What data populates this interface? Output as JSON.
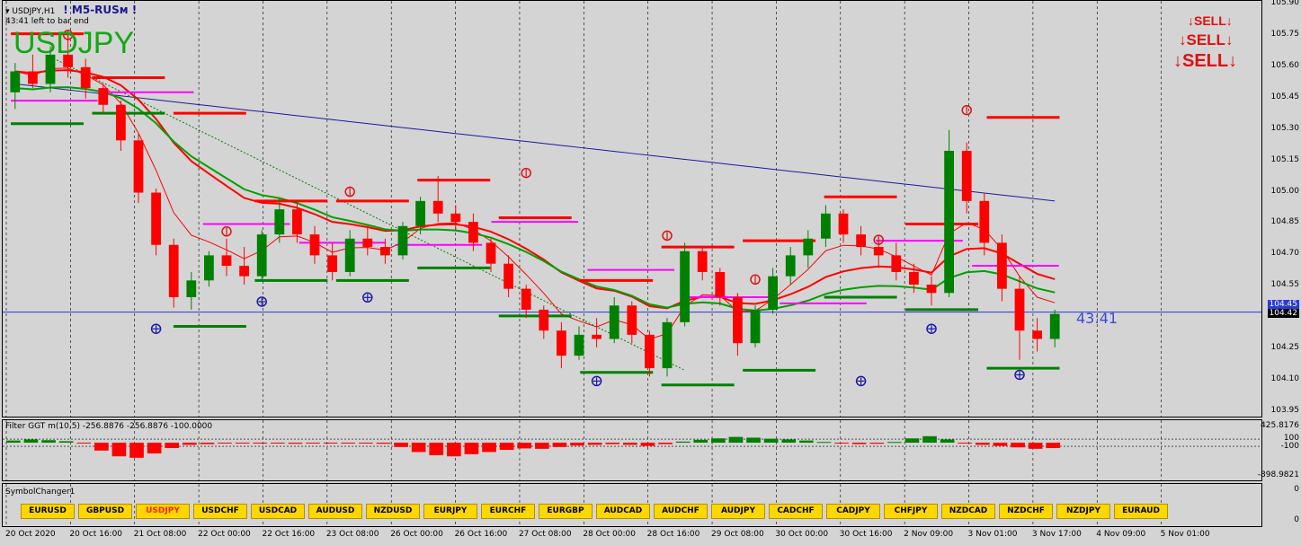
{
  "header": {
    "symbol_tf": "USDJPY,H1",
    "brand": "! M5-RUSм !",
    "bar_timer": "43:41 left to bar end",
    "big_symbol": "USDJPY",
    "timer_big": "43:41"
  },
  "sell_signals": [
    "SELL",
    "SELL",
    "SELL"
  ],
  "price_scale": [
    "105.90",
    "105.75",
    "105.60",
    "105.45",
    "105.30",
    "105.15",
    "105.00",
    "104.85",
    "104.70",
    "104.55",
    "104.42",
    "104.25",
    "104.10",
    "103.95"
  ],
  "price_tags": {
    "bid": "104.42",
    "ask": "104.45"
  },
  "indicator": {
    "label": "Filter GGT m(10,5) -256.8876 -256.8876 -100.0000",
    "scale": [
      "425.8176",
      "100",
      "-100",
      "-898.9821"
    ]
  },
  "symbol_changer": {
    "title": "SymbolChanger1",
    "scale": [
      "0",
      "0"
    ],
    "active": "USDJPY",
    "symbols": [
      "EURUSD",
      "GBPUSD",
      "USDJPY",
      "USDCHF",
      "USDCAD",
      "AUDUSD",
      "NZDUSD",
      "EURJPY",
      "EURCHF",
      "EURGBP",
      "AUDCAD",
      "AUDCHF",
      "AUDJPY",
      "CADCHF",
      "CADJPY",
      "CHFJPY",
      "NZDCAD",
      "NZDCHF",
      "NZDJPY",
      "EURAUD"
    ]
  },
  "time_axis": [
    "20 Oct 2020",
    "20 Oct 16:00",
    "21 Oct 08:00",
    "22 Oct 00:00",
    "22 Oct 16:00",
    "23 Oct 08:00",
    "26 Oct 00:00",
    "26 Oct 16:00",
    "27 Oct 08:00",
    "28 Oct 00:00",
    "28 Oct 16:00",
    "29 Oct 08:00",
    "30 Oct 00:00",
    "30 Oct 16:00",
    "2 Nov 09:00",
    "3 Nov 01:00",
    "3 Nov 17:00",
    "4 Nov 09:00",
    "5 Nov 01:00"
  ],
  "colors": {
    "bull": "#008000",
    "bear": "#ff0000",
    "ma_fast": "#ff0000",
    "ma_slow": "#00a000",
    "ma_long": "#1a1aa0",
    "resistance": "#ff0000",
    "support": "#008000",
    "pivot": "#ff00ff",
    "button": "#ffd700",
    "background": "#d4d4d4"
  },
  "chart_data": {
    "type": "candlestick",
    "symbol": "USDJPY",
    "timeframe": "H1",
    "ylim": [
      103.95,
      105.9
    ],
    "current_price": 104.42,
    "candles": [
      [
        105.48,
        105.62,
        105.4,
        105.58
      ],
      [
        105.58,
        105.66,
        105.5,
        105.52
      ],
      [
        105.52,
        105.7,
        105.48,
        105.66
      ],
      [
        105.66,
        105.78,
        105.55,
        105.6
      ],
      [
        105.6,
        105.64,
        105.45,
        105.5
      ],
      [
        105.5,
        105.52,
        105.38,
        105.42
      ],
      [
        105.42,
        105.44,
        105.2,
        105.25
      ],
      [
        105.25,
        105.28,
        104.95,
        105.0
      ],
      [
        105.0,
        105.02,
        104.7,
        104.75
      ],
      [
        104.75,
        104.78,
        104.45,
        104.5
      ],
      [
        104.5,
        104.62,
        104.44,
        104.58
      ],
      [
        104.58,
        104.72,
        104.55,
        104.7
      ],
      [
        104.7,
        104.78,
        104.6,
        104.65
      ],
      [
        104.65,
        104.74,
        104.56,
        104.6
      ],
      [
        104.6,
        104.82,
        104.58,
        104.8
      ],
      [
        104.8,
        104.97,
        104.76,
        104.92
      ],
      [
        104.92,
        104.96,
        104.76,
        104.8
      ],
      [
        104.8,
        104.84,
        104.66,
        104.7
      ],
      [
        104.7,
        104.76,
        104.58,
        104.62
      ],
      [
        104.62,
        104.82,
        104.6,
        104.78
      ],
      [
        104.78,
        104.84,
        104.7,
        104.74
      ],
      [
        104.74,
        104.78,
        104.66,
        104.7
      ],
      [
        104.7,
        104.86,
        104.68,
        104.84
      ],
      [
        104.84,
        104.98,
        104.8,
        104.96
      ],
      [
        104.96,
        105.08,
        104.86,
        104.9
      ],
      [
        104.9,
        104.94,
        104.82,
        104.86
      ],
      [
        104.86,
        104.9,
        104.72,
        104.76
      ],
      [
        104.76,
        104.78,
        104.62,
        104.66
      ],
      [
        104.66,
        104.7,
        104.5,
        104.54
      ],
      [
        104.54,
        104.56,
        104.4,
        104.44
      ],
      [
        104.44,
        104.46,
        104.3,
        104.34
      ],
      [
        104.34,
        104.38,
        104.16,
        104.22
      ],
      [
        104.22,
        104.36,
        104.2,
        104.32
      ],
      [
        104.32,
        104.4,
        104.26,
        104.3
      ],
      [
        104.3,
        104.5,
        104.28,
        104.46
      ],
      [
        104.46,
        104.48,
        104.28,
        104.32
      ],
      [
        104.32,
        104.34,
        104.12,
        104.16
      ],
      [
        104.16,
        104.4,
        104.12,
        104.38
      ],
      [
        104.38,
        104.76,
        104.36,
        104.72
      ],
      [
        104.72,
        104.74,
        104.58,
        104.62
      ],
      [
        104.62,
        104.64,
        104.46,
        104.5
      ],
      [
        104.5,
        104.52,
        104.22,
        104.28
      ],
      [
        104.28,
        104.46,
        104.26,
        104.44
      ],
      [
        104.44,
        104.64,
        104.42,
        104.6
      ],
      [
        104.6,
        104.74,
        104.56,
        104.7
      ],
      [
        104.7,
        104.82,
        104.64,
        104.78
      ],
      [
        104.78,
        104.94,
        104.74,
        104.9
      ],
      [
        104.9,
        104.92,
        104.76,
        104.8
      ],
      [
        104.8,
        104.84,
        104.7,
        104.74
      ],
      [
        104.74,
        104.78,
        104.64,
        104.7
      ],
      [
        104.7,
        104.76,
        104.58,
        104.62
      ],
      [
        104.62,
        104.66,
        104.52,
        104.56
      ],
      [
        104.56,
        104.6,
        104.46,
        104.52
      ],
      [
        104.52,
        105.3,
        104.5,
        105.2
      ],
      [
        105.2,
        105.24,
        104.9,
        104.96
      ],
      [
        104.96,
        105.0,
        104.7,
        104.76
      ],
      [
        104.76,
        104.8,
        104.48,
        104.54
      ],
      [
        104.54,
        104.6,
        104.2,
        104.34
      ],
      [
        104.34,
        104.4,
        104.24,
        104.3
      ],
      [
        104.3,
        104.44,
        104.26,
        104.42
      ]
    ],
    "signals_up": [
      104.4,
      104.53,
      104.55,
      104.15,
      104.15,
      104.4,
      104.18
    ],
    "signals_down": [
      105.72,
      104.78,
      104.97,
      105.06,
      104.76,
      104.74,
      105.36,
      104.55
    ],
    "resistance_levels": [
      105.76,
      105.55,
      105.38,
      104.96,
      104.96,
      105.06,
      104.88,
      104.58,
      104.74,
      104.77,
      104.98,
      104.85,
      105.36
    ],
    "support_levels": [
      105.33,
      105.38,
      104.36,
      104.58,
      104.58,
      104.64,
      104.41,
      104.14,
      104.08,
      104.15,
      104.5,
      104.44,
      104.16
    ],
    "pivot_levels": [
      105.44,
      105.48,
      104.85,
      104.76,
      104.75,
      104.86,
      104.63,
      104.5,
      104.47,
      104.77,
      104.65
    ]
  },
  "indicator_data": {
    "type": "histogram",
    "ylim": [
      -898.9821,
      425.8176
    ],
    "values": [
      60,
      90,
      70,
      40,
      -20,
      -220,
      -380,
      -420,
      -300,
      -150,
      -60,
      -40,
      -20,
      -10,
      -15,
      -20,
      -30,
      -20,
      -10,
      -15,
      -20,
      -30,
      -120,
      -260,
      -350,
      -380,
      -320,
      -260,
      -200,
      -160,
      -170,
      -120,
      -80,
      -60,
      -40,
      -60,
      -90,
      -40,
      30,
      80,
      120,
      160,
      140,
      110,
      90,
      60,
      20,
      -20,
      -40,
      -30,
      20,
      120,
      180,
      90,
      -20,
      -60,
      -90,
      -130,
      -170,
      -150
    ]
  }
}
